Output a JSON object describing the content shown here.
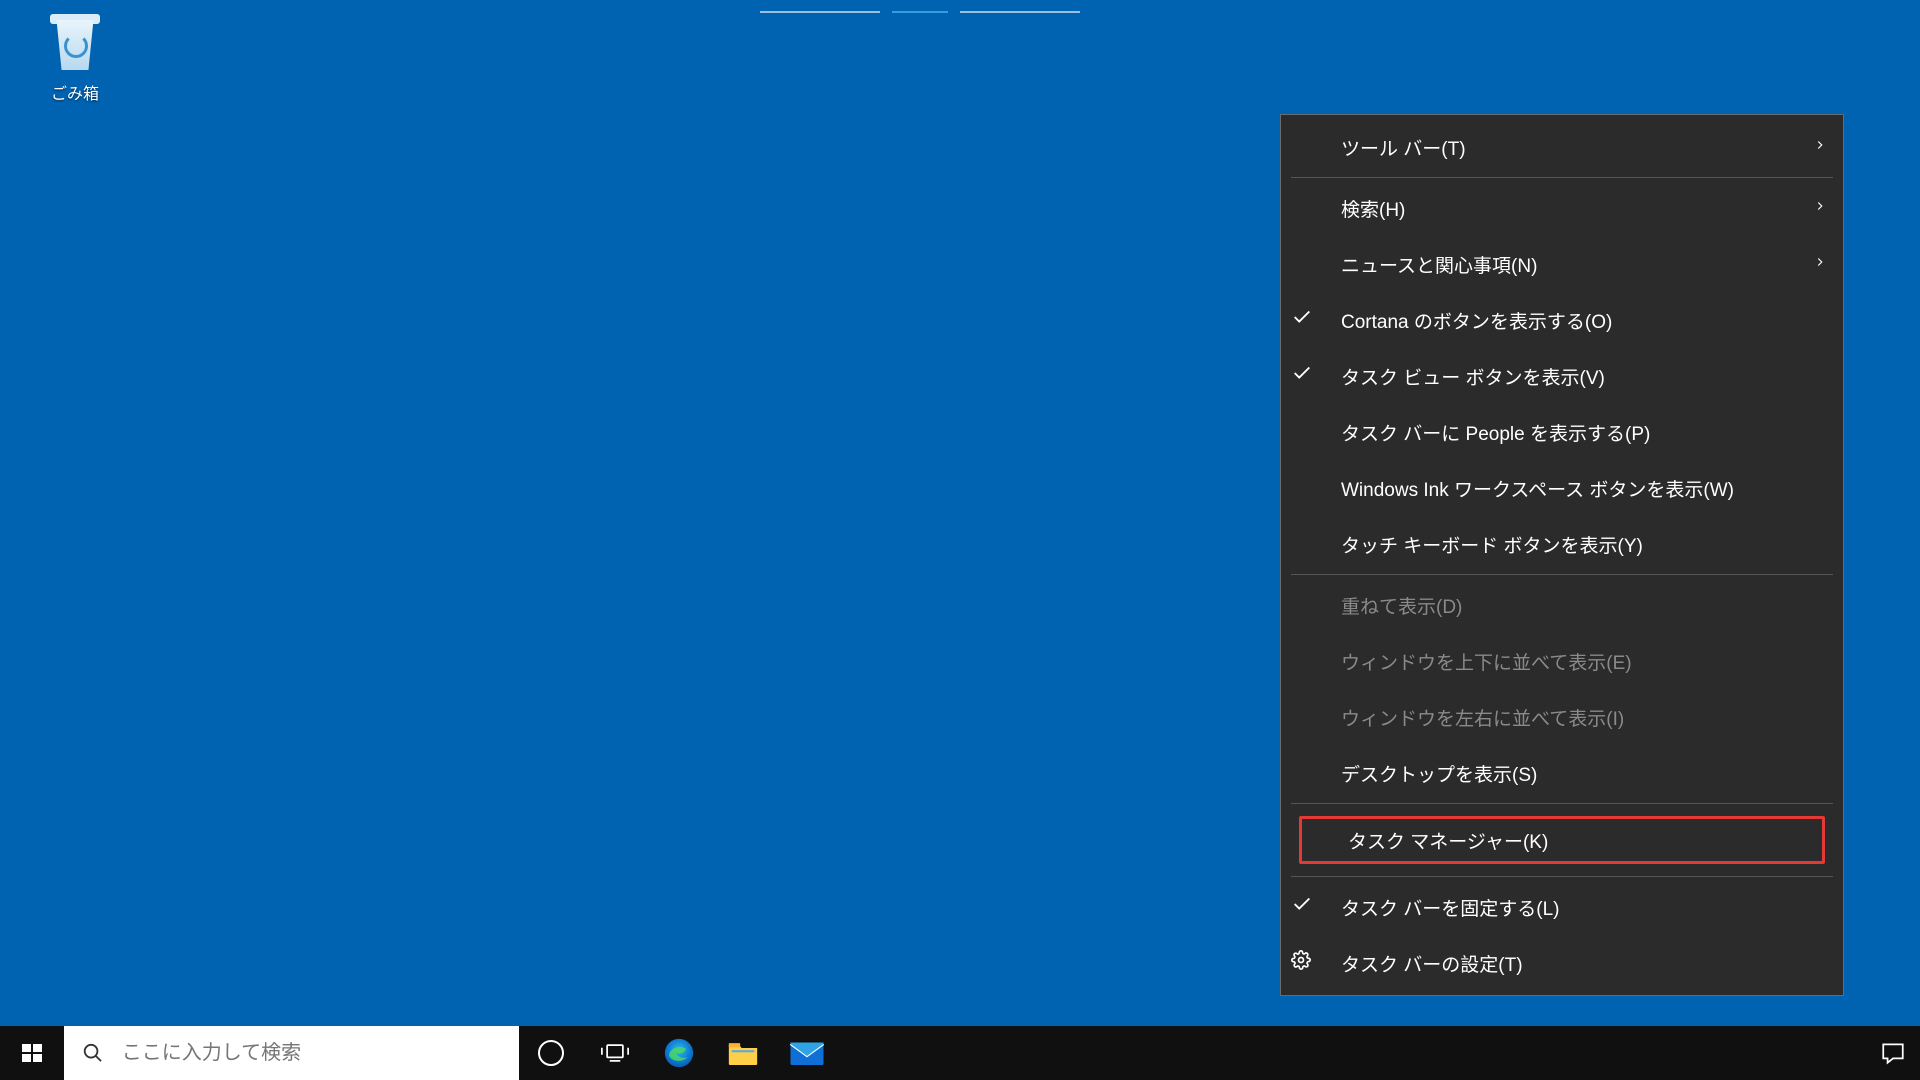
{
  "desktop": {
    "recycle_bin_label": "ごみ箱"
  },
  "taskbar": {
    "search_placeholder": "ここに入力して検索"
  },
  "context_menu": {
    "items": [
      {
        "label": "ツール バー(T)",
        "submenu": true
      },
      {
        "label": "検索(H)",
        "submenu": true
      },
      {
        "label": "ニュースと関心事項(N)",
        "submenu": true
      },
      {
        "label": "Cortana のボタンを表示する(O)",
        "checked": true
      },
      {
        "label": "タスク ビュー ボタンを表示(V)",
        "checked": true
      },
      {
        "label": "タスク バーに People を表示する(P)"
      },
      {
        "label": "Windows Ink ワークスペース ボタンを表示(W)"
      },
      {
        "label": "タッチ キーボード ボタンを表示(Y)"
      },
      {
        "label": "重ねて表示(D)",
        "disabled": true
      },
      {
        "label": "ウィンドウを上下に並べて表示(E)",
        "disabled": true
      },
      {
        "label": "ウィンドウを左右に並べて表示(I)",
        "disabled": true
      },
      {
        "label": "デスクトップを表示(S)"
      },
      {
        "label": "タスク マネージャー(K)",
        "highlighted": true
      },
      {
        "label": "タスク バーを固定する(L)",
        "checked": true
      },
      {
        "label": "タスク バーの設定(T)",
        "gear": true
      }
    ]
  }
}
